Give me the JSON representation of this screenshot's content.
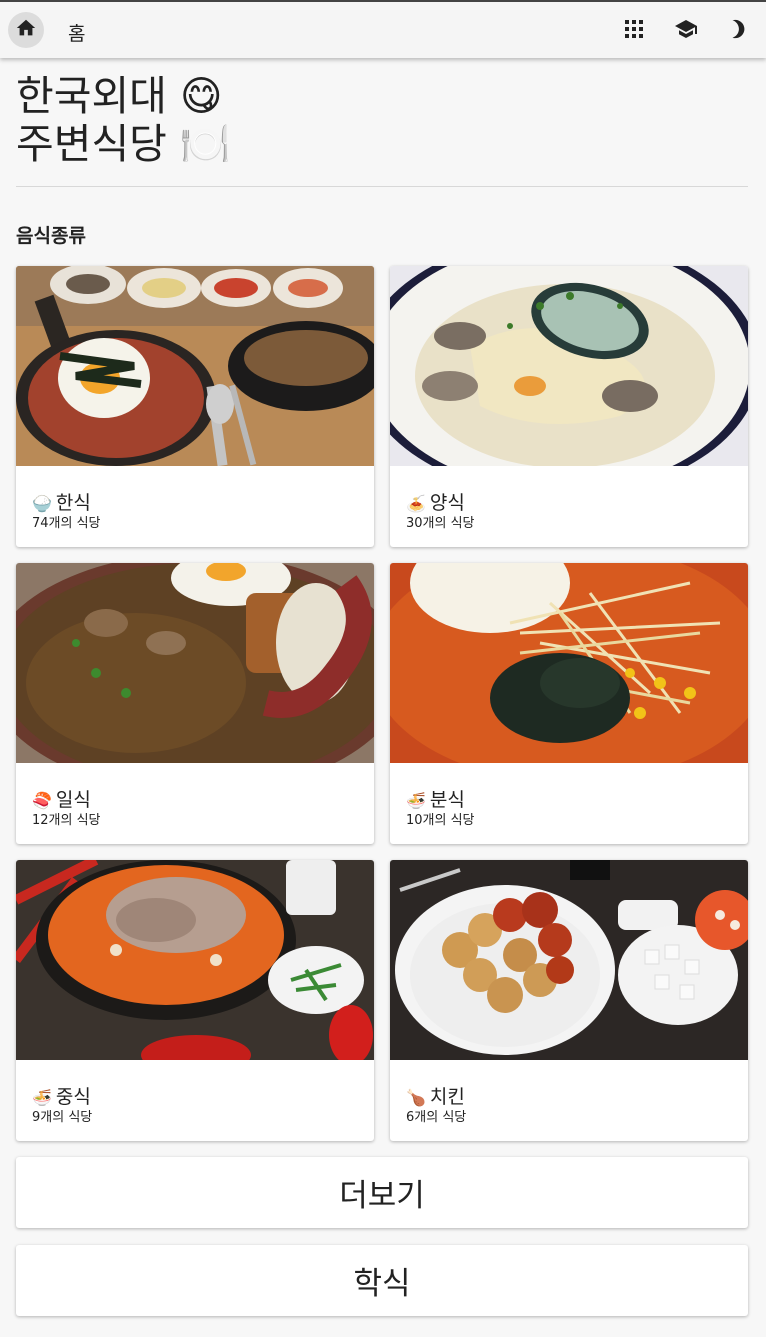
{
  "topbar": {
    "title": "홈",
    "icons": [
      "home-icon",
      "apps-grid-icon",
      "graduation-cap-icon",
      "dark-mode-icon"
    ]
  },
  "header": {
    "title_line1": "한국외대 😋",
    "title_line2": "주변식당 🍽️"
  },
  "section": {
    "title": "음식종류"
  },
  "categories": [
    {
      "emoji": "🍚",
      "name": "한식",
      "count": "74개의 식당"
    },
    {
      "emoji": "🍝",
      "name": "양식",
      "count": "30개의 식당"
    },
    {
      "emoji": "🍣",
      "name": "일식",
      "count": "12개의 식당"
    },
    {
      "emoji": "🍜",
      "name": "분식",
      "count": "10개의 식당"
    },
    {
      "emoji": "🍜",
      "name": "중식",
      "count": "9개의 식당"
    },
    {
      "emoji": "🍗",
      "name": "치킨",
      "count": "6개의 식당"
    }
  ],
  "buttons": {
    "more": "더보기",
    "cafeteria": "학식"
  }
}
